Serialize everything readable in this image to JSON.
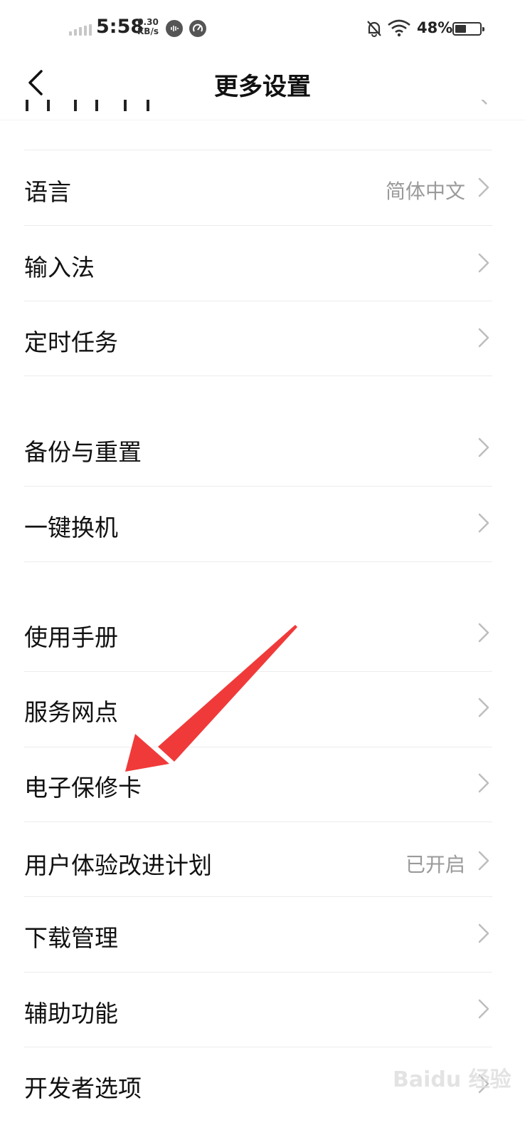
{
  "status_bar": {
    "time": "5:58",
    "rate_value": "0.30",
    "rate_unit": "KB/s",
    "battery_percent": "48%",
    "battery_level": 0.48,
    "icons": [
      "signal-icon",
      "voice-assistant-icon",
      "speed-icon",
      "mute-bell-icon",
      "wifi-icon",
      "battery-icon"
    ]
  },
  "header": {
    "title": "更多设置",
    "back_icon": "chevron-left-icon"
  },
  "settings": [
    {
      "label": "语言",
      "value": "简体中文"
    },
    {
      "label": "输入法",
      "value": ""
    },
    {
      "label": "定时任务",
      "value": ""
    },
    {
      "label": "备份与重置",
      "value": ""
    },
    {
      "label": "一键换机",
      "value": ""
    },
    {
      "label": "使用手册",
      "value": ""
    },
    {
      "label": "服务网点",
      "value": ""
    },
    {
      "label": "电子保修卡",
      "value": ""
    },
    {
      "label": "用户体验改进计划",
      "value": "已开启"
    },
    {
      "label": "下载管理",
      "value": ""
    },
    {
      "label": "辅助功能",
      "value": ""
    },
    {
      "label": "开发者选项",
      "value": ""
    }
  ],
  "annotation": {
    "arrow_color": "#f03a3a"
  },
  "watermark": {
    "text": "Baidu 经验"
  }
}
